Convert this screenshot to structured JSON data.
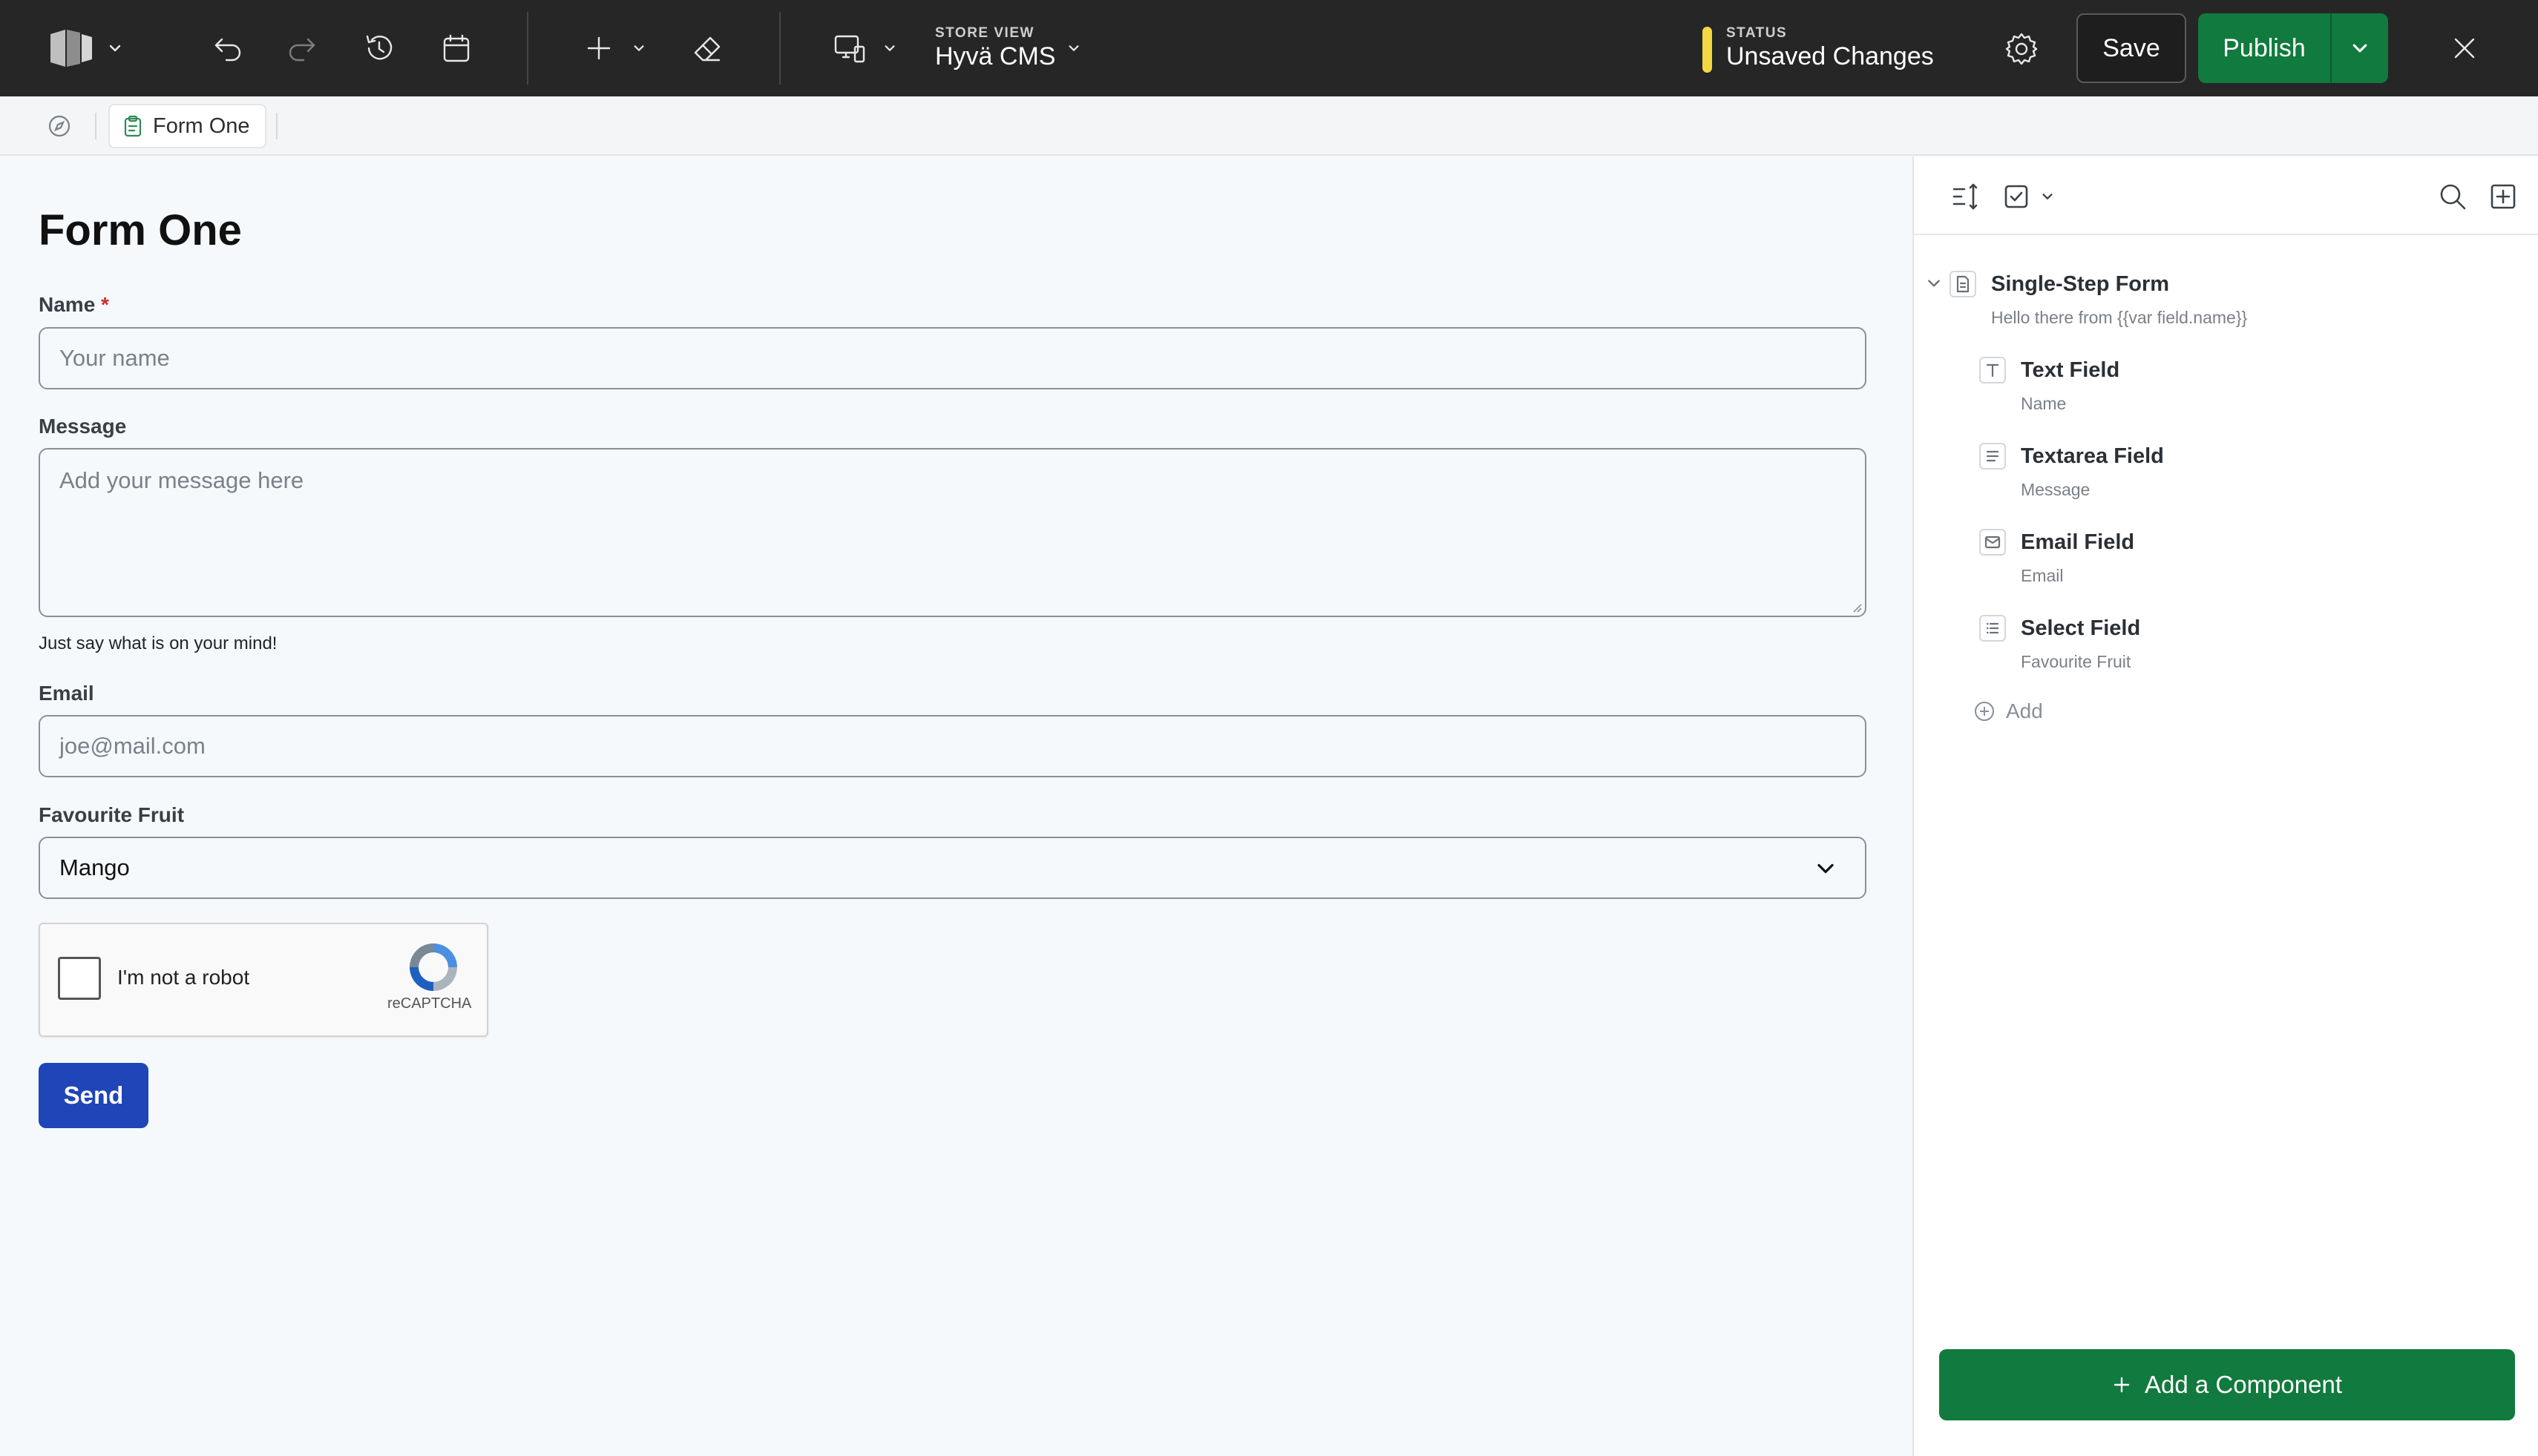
{
  "topbar": {
    "store_view_label": "STORE VIEW",
    "store_view_value": "Hyvä CMS",
    "status_label": "STATUS",
    "status_value": "Unsaved Changes",
    "status_color": "#f3d843",
    "save_label": "Save",
    "publish_label": "Publish",
    "accent_color": "#117a3e"
  },
  "breadcrumb": {
    "tab_label": "Form One"
  },
  "form": {
    "title": "Form One",
    "name_label": "Name",
    "name_required_mark": "*",
    "name_placeholder": "Your name",
    "message_label": "Message",
    "message_placeholder": "Add your message here",
    "message_hint": "Just say what is on your mind!",
    "email_label": "Email",
    "email_placeholder": "joe@mail.com",
    "fruit_label": "Favourite Fruit",
    "fruit_selected": "Mango",
    "recaptcha_label": "I'm not a robot",
    "recaptcha_brand": "reCAPTCHA",
    "send_label": "Send",
    "send_color": "#1f45b8"
  },
  "panel": {
    "root": {
      "title": "Single-Step Form",
      "subtitle": "Hello there from {{var field.name}}"
    },
    "children": [
      {
        "title": "Text Field",
        "subtitle": "Name",
        "icon": "text-type-icon"
      },
      {
        "title": "Textarea Field",
        "subtitle": "Message",
        "icon": "textarea-icon"
      },
      {
        "title": "Email Field",
        "subtitle": "Email",
        "icon": "envelope-icon"
      },
      {
        "title": "Select Field",
        "subtitle": "Favourite Fruit",
        "icon": "list-icon"
      }
    ],
    "add_label": "Add",
    "add_component_label": "Add a Component"
  }
}
